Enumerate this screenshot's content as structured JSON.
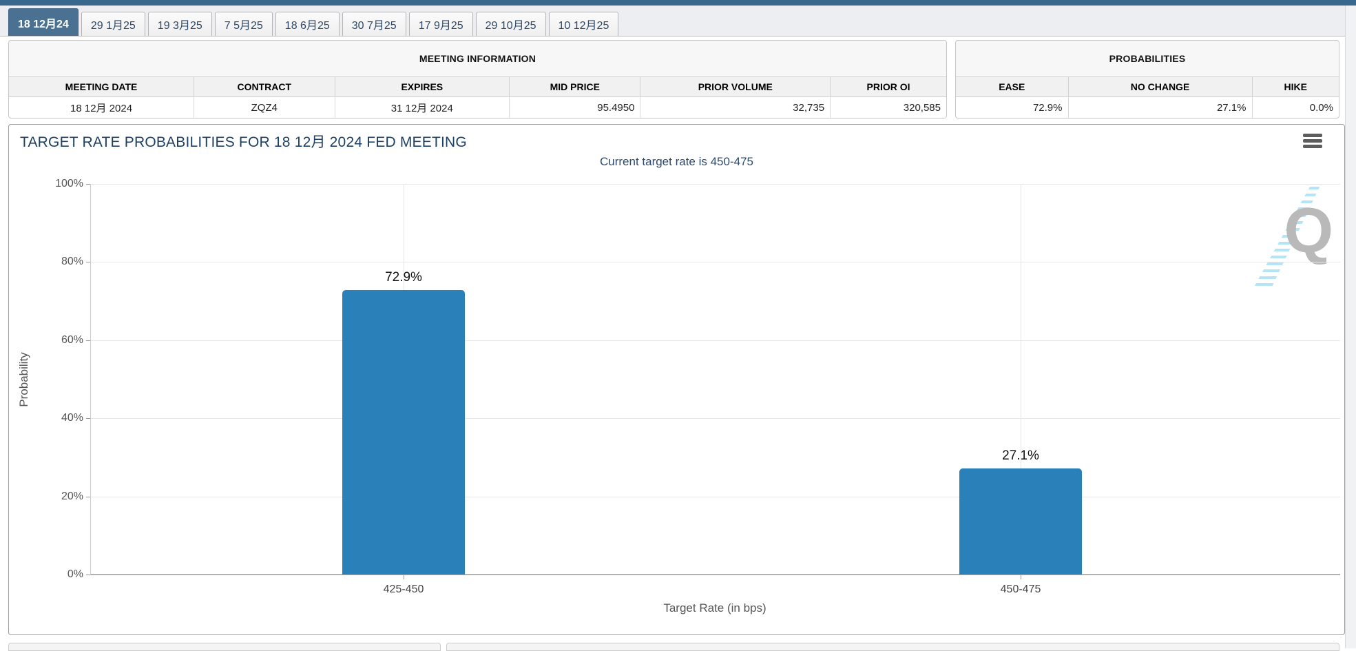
{
  "tabs": [
    {
      "label": "18 12月24",
      "active": true
    },
    {
      "label": "29 1月25",
      "active": false
    },
    {
      "label": "19 3月25",
      "active": false
    },
    {
      "label": "7 5月25",
      "active": false
    },
    {
      "label": "18 6月25",
      "active": false
    },
    {
      "label": "30 7月25",
      "active": false
    },
    {
      "label": "17 9月25",
      "active": false
    },
    {
      "label": "29 10月25",
      "active": false
    },
    {
      "label": "10 12月25",
      "active": false
    }
  ],
  "meeting_information": {
    "title": "MEETING INFORMATION",
    "columns": [
      "MEETING DATE",
      "CONTRACT",
      "EXPIRES",
      "MID PRICE",
      "PRIOR VOLUME",
      "PRIOR OI"
    ],
    "row": [
      "18 12月 2024",
      "ZQZ4",
      "31 12月 2024",
      "95.4950",
      "32,735",
      "320,585"
    ]
  },
  "probabilities": {
    "title": "PROBABILITIES",
    "columns": [
      "EASE",
      "NO CHANGE",
      "HIKE"
    ],
    "row": [
      "72.9%",
      "27.1%",
      "0.0%"
    ]
  },
  "chart": {
    "title": "TARGET RATE PROBABILITIES FOR 18 12月 2024 FED MEETING",
    "subtitle": "Current target rate is 450-475",
    "menu_icon": "hamburger-icon",
    "watermark_letter": "Q"
  },
  "chart_data": {
    "type": "bar",
    "categories": [
      "425-450",
      "450-475"
    ],
    "values": [
      72.9,
      27.1
    ],
    "value_labels": [
      "72.9%",
      "27.1%"
    ],
    "title": "TARGET RATE PROBABILITIES FOR 18 12月 2024 FED MEETING",
    "subtitle": "Current target rate is 450-475",
    "xlabel": "Target Rate (in bps)",
    "ylabel": "Probability",
    "ylim": [
      0,
      100
    ],
    "ytick_labels": [
      "0%",
      "20%",
      "40%",
      "60%",
      "80%",
      "100%"
    ],
    "grid": true,
    "legend": false,
    "bar_color": "#2a80b9"
  },
  "colors": {
    "accent_bar": "#38688e",
    "active_tab": "#4a7191",
    "bar": "#2a80b9",
    "chart_title": "#1d4066",
    "subtitle": "#2c4a6e"
  }
}
